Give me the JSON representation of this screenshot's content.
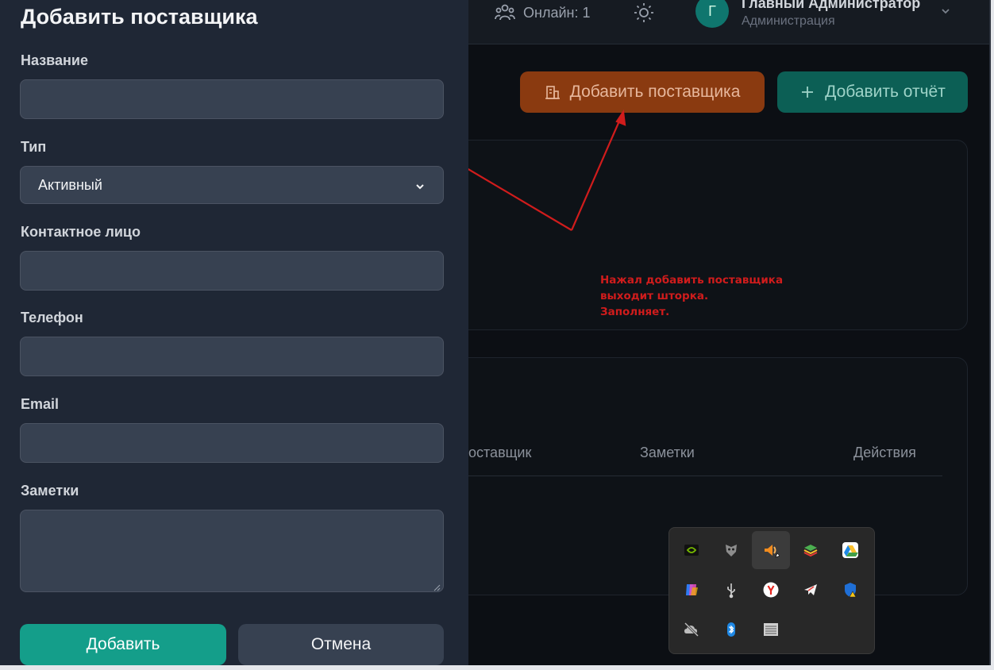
{
  "header": {
    "online_text": "Онлайн: 1",
    "online_icon": "users-icon",
    "theme_icon": "sun-icon",
    "avatar_letter": "Г",
    "user_name": "Главный Администратор",
    "user_role": "Администрация",
    "chevron_icon": "chevron-down-icon"
  },
  "actions": {
    "add_supplier_label": "Добавить поставщика",
    "add_supplier_icon": "building-icon",
    "add_report_label": "Добавить отчёт",
    "add_report_icon": "plus-icon"
  },
  "table": {
    "headers": [
      "оставщик",
      "Заметки",
      "Действия"
    ]
  },
  "annotation": {
    "lines": [
      "Нажал добавить поставщика",
      "выходит шторка.",
      "Заполняет."
    ],
    "color": "#d01c1c"
  },
  "drawer": {
    "title": "Добавить поставщика",
    "fields": {
      "name": {
        "label": "Название",
        "value": ""
      },
      "type": {
        "label": "Тип",
        "value": "Активный"
      },
      "contact": {
        "label": "Контактное лицо",
        "value": ""
      },
      "phone": {
        "label": "Телефон",
        "value": ""
      },
      "email": {
        "label": "Email",
        "value": ""
      },
      "notes": {
        "label": "Заметки",
        "value": ""
      }
    },
    "submit_label": "Добавить",
    "cancel_label": "Отмена"
  },
  "tray": {
    "icons": [
      "nvidia-icon",
      "gamer-mask-icon",
      "audio-app-icon",
      "bluestacks-icon",
      "google-drive-icon",
      "copilot-icon",
      "usb-icon",
      "yandex-browser-icon",
      "telegram-icon",
      "windows-security-warning-icon",
      "cloud-offline-icon",
      "bluetooth-icon",
      "touch-keyboard-icon"
    ]
  },
  "colors": {
    "accent_teal": "#149e8a",
    "accent_orange": "#8a3a10",
    "drawer_bg": "#1f2735",
    "page_bg": "#0c0f14"
  }
}
